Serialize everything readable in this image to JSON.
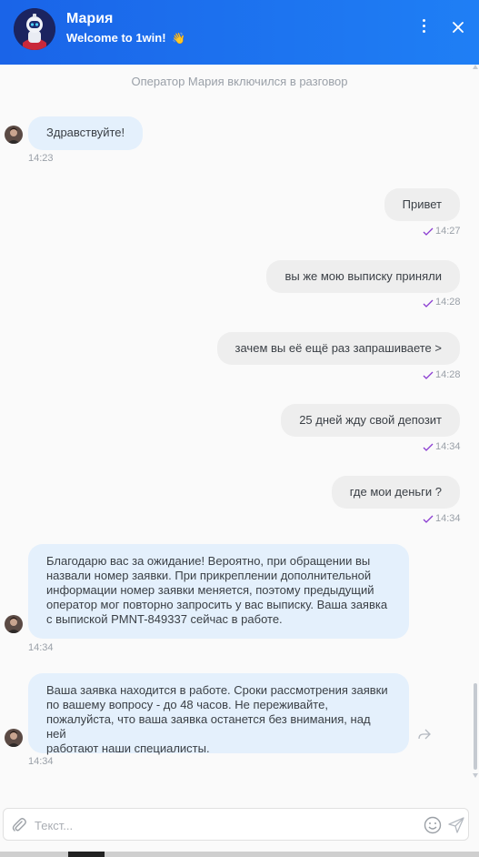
{
  "header": {
    "name": "Мария",
    "subtitle": "Welcome to 1win!",
    "wave_emoji": "👋"
  },
  "chat": {
    "system_note": "Оператор Мария включился в разговор",
    "messages": [
      {
        "from": "operator",
        "text": "Здравствуйте!",
        "time": "14:23"
      },
      {
        "from": "user",
        "text": "Привет",
        "time": "14:27"
      },
      {
        "from": "user",
        "text": "вы же мою выписку приняли",
        "time": "14:28"
      },
      {
        "from": "user",
        "text": "зачем вы её ещё раз запрашиваете >",
        "time": "14:28"
      },
      {
        "from": "user",
        "text": "25 дней жду свой депозит",
        "time": "14:34"
      },
      {
        "from": "user",
        "text": "где мои деньги ?",
        "time": "14:34"
      },
      {
        "from": "operator",
        "lines": [
          "Благодарю вас за ожидание! Вероятно, при обращении вы",
          "назвали номер заявки. При прикреплении дополнительной",
          "информации номер заявки меняется, поэтому предыдущий",
          "оператор мог повторно запросить у вас выписку. Ваша заявка",
          "с выпиской PMNT-849337 сейчас в работе."
        ],
        "time": "14:34"
      },
      {
        "from": "operator",
        "lines": [
          "Ваша заявка находится в работе. Сроки рассмотрения заявки",
          "по вашему вопросу - до 48 часов. Не переживайте,",
          "пожалуйста, что ваша заявка останется без внимания, над ней",
          "работают наши специалисты."
        ],
        "time": "14:34"
      }
    ]
  },
  "composer": {
    "placeholder": "Текст..."
  },
  "icons": {
    "menu": "more-vertical-icon",
    "close": "close-icon",
    "attach": "paperclip-icon",
    "emoji": "smile-icon",
    "send": "send-icon",
    "forward": "forward-icon",
    "read": "check-icon"
  },
  "colors": {
    "header": "#1a64e8",
    "incoming_bubble": "#e4f0fc",
    "outgoing_bubble": "#eeeeee",
    "check": "#8a3bd1"
  }
}
